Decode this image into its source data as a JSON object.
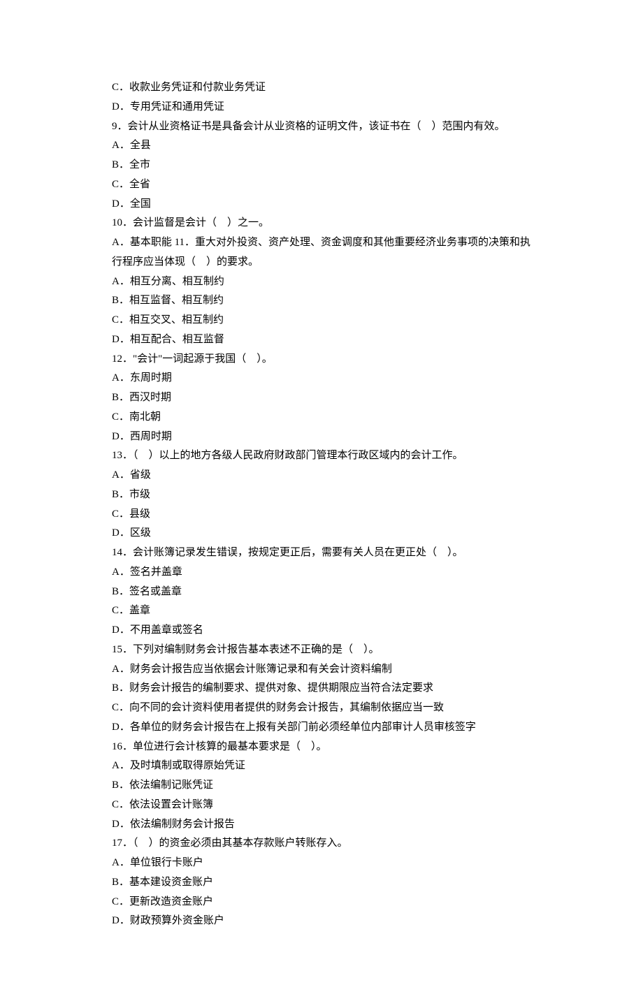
{
  "lines": [
    "C．收款业务凭证和付款业务凭证",
    "D．专用凭证和通用凭证",
    "9．会计从业资格证书是具备会计从业资格的证明文件，该证书在（　）范围内有效。",
    "A．全县",
    "B．全市",
    "C．全省",
    "D．全国",
    "10．会计监督是会计（　）之一。",
    "A．基本职能 11．重大对外投资、资产处理、资金调度和其他重要经济业务事项的决策和执行程序应当体现（　）的要求。",
    "A．相互分离、相互制约",
    "B．相互监督、相互制约",
    "C．相互交叉、相互制约",
    "D．相互配合、相互监督",
    "12．\"会计\"一词起源于我国（　）。",
    "A．东周时期",
    "B．西汉时期",
    "C．南北朝",
    "D．西周时期",
    "13．（　）以上的地方各级人民政府财政部门管理本行政区域内的会计工作。",
    "A．省级",
    "B．市级",
    "C．县级",
    "D．区级",
    "14．会计账簿记录发生错误，按规定更正后，需要有关人员在更正处（　）。",
    "A．签名并盖章",
    "B．签名或盖章",
    "C．盖章",
    "D．不用盖章或签名",
    "15．下列对编制财务会计报告基本表述不正确的是（　）。",
    "A．财务会计报告应当依据会计账簿记录和有关会计资料编制",
    "B．财务会计报告的编制要求、提供对象、提供期限应当符合法定要求",
    "C．向不同的会计资料使用者提供的财务会计报告，其编制依据应当一致",
    "D．各单位的财务会计报告在上报有关部门前必须经单位内部审计人员审核签字",
    "16．单位进行会计核算的最基本要求是（　）。",
    "A．及时填制或取得原始凭证",
    "B．依法编制记账凭证",
    "C．依法设置会计账簿",
    "D．依法编制财务会计报告",
    "17．（　）的资金必须由其基本存款账户转账存入。",
    "A．单位银行卡账户",
    "B．基本建设资金账户",
    "C．更新改造资金账户",
    "D．财政预算外资金账户"
  ]
}
